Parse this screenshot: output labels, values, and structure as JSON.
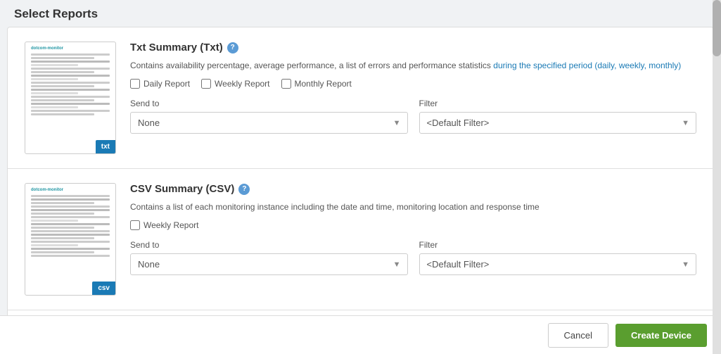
{
  "page": {
    "title": "Select Reports"
  },
  "reports": [
    {
      "id": "txt",
      "title": "Txt Summary (Txt)",
      "badge": "txt",
      "description": "Contains availability percentage, average performance, a list of errors and performance statistics during the specified period (daily, weekly, monthly)",
      "checkboxes": [
        {
          "label": "Daily Report",
          "checked": false
        },
        {
          "label": "Weekly Report",
          "checked": false
        },
        {
          "label": "Monthly Report",
          "checked": false
        }
      ],
      "send_to_label": "Send to",
      "send_to_value": "None",
      "filter_label": "Filter",
      "filter_value": "<Default Filter>"
    },
    {
      "id": "csv",
      "title": "CSV Summary (CSV)",
      "badge": "csv",
      "description": "Contains a list of each monitoring instance including the date and time, monitoring location and response time",
      "checkboxes": [
        {
          "label": "Weekly Report",
          "checked": false
        }
      ],
      "send_to_label": "Send to",
      "send_to_value": "None",
      "filter_label": "Filter",
      "filter_value": "<Default Filter>"
    }
  ],
  "footer": {
    "cancel_label": "Cancel",
    "create_label": "Create Device"
  }
}
